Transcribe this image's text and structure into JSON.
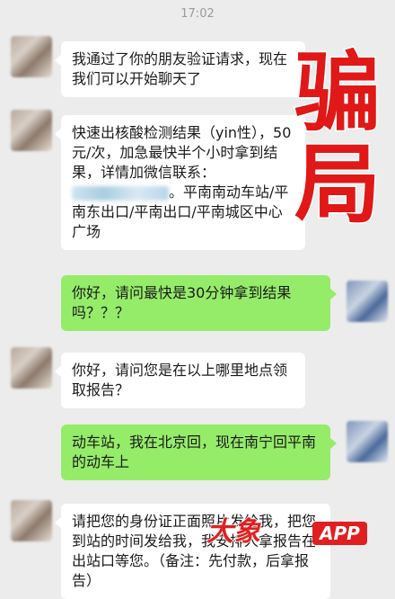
{
  "timestamp": "17:02",
  "stamp": {
    "text": "骗局",
    "color": "#e01818"
  },
  "messages": [
    {
      "side": "in",
      "text": "我通过了你的朋友验证请求，现在我们可以开始聊天了"
    },
    {
      "side": "in",
      "text_a": "快速出核酸检测结果（yin性），50元/次，加急最快半个小时拿到结果，详情加微信联系：",
      "text_b": "。平南南动车站/平南东出口/平南出口/平南城区中心广场"
    },
    {
      "side": "out",
      "text": "你好，请问最快是30分钟拿到结果吗？？？"
    },
    {
      "side": "in",
      "text": "你好，请问您是在以上哪里地点领取报告？"
    },
    {
      "side": "out",
      "text": "动车站，我在北京回，现在南宁回平南的动车上"
    },
    {
      "side": "in",
      "text": "请把您的身份证正面照片发给我，把您到站的时间发给我，我安排人拿报告在出站口等您。（备注：先付款，后拿报告）"
    }
  ],
  "watermark": {
    "logo": "大象",
    "app": "APP"
  },
  "colors": {
    "background": "#ececec",
    "incoming": "#ffffff",
    "outgoing": "#95ec69"
  }
}
